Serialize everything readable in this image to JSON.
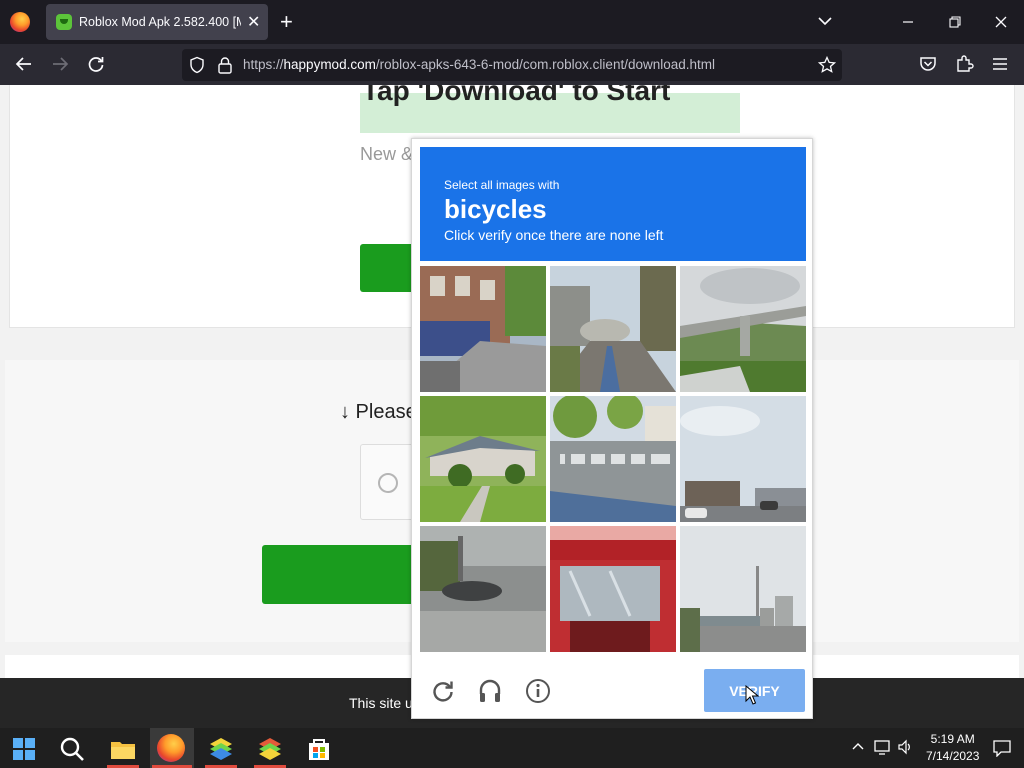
{
  "browser": {
    "tab_title": "Roblox Mod Apk 2.582.400 [Mo",
    "url_prefix": "https://",
    "url_domain": "happymod.com",
    "url_path": "/roblox-apks-643-6-mod/com.roblox.client/download.html"
  },
  "page": {
    "heading": "Tap 'Download' to Start",
    "new_text": "New &",
    "please_text": "↓ Please",
    "cookie_text": "This site u"
  },
  "captcha": {
    "subtitle": "Select all images with",
    "target": "bicycles",
    "instruction": "Click verify once there are none left",
    "verify_label": "VERIFY",
    "tiles": [
      {
        "name": "tile-city-street-storefront"
      },
      {
        "name": "tile-road-bridge-trees"
      },
      {
        "name": "tile-highway-overpass"
      },
      {
        "name": "tile-house-lawn"
      },
      {
        "name": "tile-crosswalk"
      },
      {
        "name": "tile-parking-lot-sky"
      },
      {
        "name": "tile-dark-street-car"
      },
      {
        "name": "tile-red-building"
      },
      {
        "name": "tile-city-skyline-road"
      }
    ]
  },
  "taskbar": {
    "time": "5:19 AM",
    "date": "7/14/2023"
  }
}
